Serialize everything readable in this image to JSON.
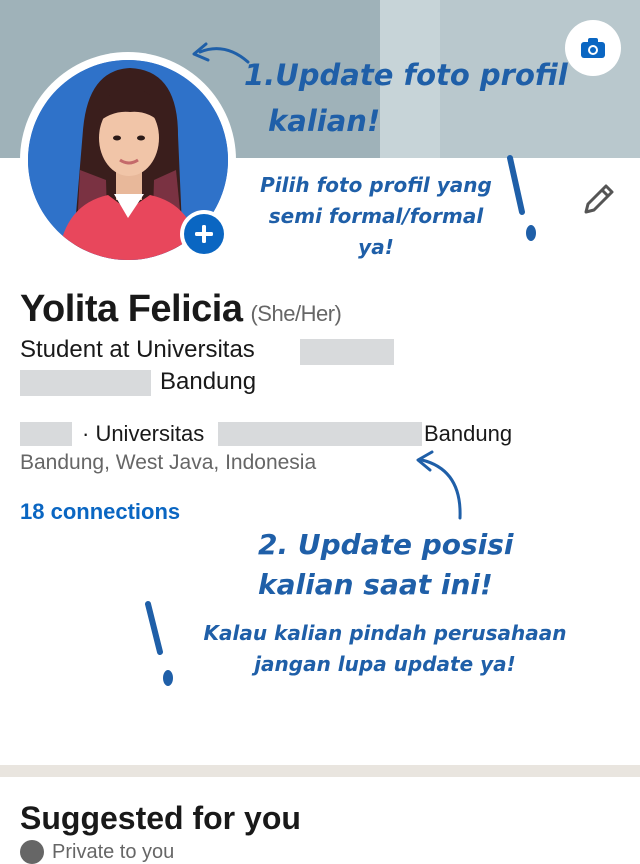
{
  "profile": {
    "name": "Yolita Felicia",
    "pronouns": "(She/Her)",
    "headline_part1": "Student at Universitas",
    "headline_part2": "Bandung",
    "education_prefix": "· Universitas",
    "education_suffix": "Bandung",
    "location": "Bandung, West Java, Indonesia",
    "connections": "18 connections"
  },
  "annotations": {
    "step1_line1": "1.Update foto profil",
    "step1_line2": "kalian!",
    "step1_tip": "Pilih foto profil yang semi formal/formal ya!",
    "step2_line1": "2. Update posisi",
    "step2_line2": "kalian saat ini!",
    "step2_tip": "Kalau kalian pindah perusahaan jangan lupa update ya!"
  },
  "sections": {
    "suggested_title": "Suggested for you",
    "suggested_subtitle": "Private to you"
  },
  "icons": {
    "camera": "camera-icon",
    "add": "plus-icon",
    "edit": "pencil-icon",
    "visibility": "eye-icon"
  },
  "colors": {
    "accent": "#0a66c2",
    "annotation": "#1f5fa8",
    "banner": "#9fb2b9"
  }
}
